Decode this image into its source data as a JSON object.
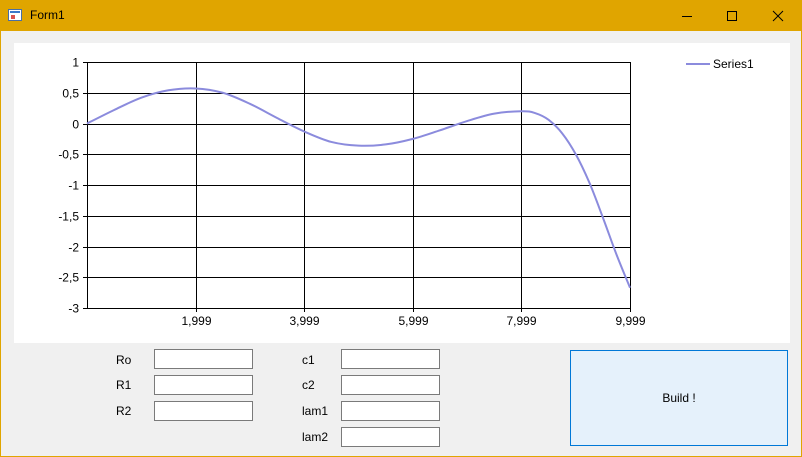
{
  "window": {
    "title": "Form1",
    "controls": {
      "minimize_icon": "minimize-icon",
      "maximize_icon": "maximize-icon",
      "close_icon": "close-icon"
    }
  },
  "colors": {
    "title_bar": "#e0a500",
    "series": "#8b8bdd",
    "button_bg": "#e5f1fb",
    "button_border": "#0078d7"
  },
  "chart_data": {
    "type": "line",
    "ylim": [
      -3,
      1
    ],
    "y_ticks": [
      1,
      0.5,
      0,
      -0.5,
      -1,
      -1.5,
      -2,
      -2.5,
      -3
    ],
    "y_tick_labels": [
      "1",
      "0,5",
      "0",
      "-0,5",
      "-1",
      "-1,5",
      "-2",
      "-2,5",
      "-3"
    ],
    "x_ticks": [
      1.999,
      3.999,
      5.999,
      7.999,
      9.999
    ],
    "x_tick_labels": [
      "1,999",
      "3,999",
      "5,999",
      "7,999",
      "9,999"
    ],
    "xlim": [
      0,
      9.999
    ],
    "grid": true,
    "legend_position": "top-right",
    "series": [
      {
        "name": "Series1",
        "x": [
          0,
          0.5,
          1,
          1.5,
          2,
          2.5,
          3,
          3.5,
          4,
          4.5,
          5,
          5.5,
          6,
          6.5,
          7,
          7.5,
          8,
          8.25,
          8.5,
          8.75,
          9,
          9.25,
          9.5,
          9.75,
          9.999
        ],
        "y": [
          0,
          0.22,
          0.42,
          0.54,
          0.57,
          0.5,
          0.32,
          0.09,
          -0.13,
          -0.3,
          -0.36,
          -0.34,
          -0.25,
          -0.11,
          0.04,
          0.16,
          0.2,
          0.17,
          0.06,
          -0.16,
          -0.5,
          -0.96,
          -1.53,
          -2.13,
          -2.67
        ]
      }
    ]
  },
  "form": {
    "ro_label": "Ro",
    "r1_label": "R1",
    "r2_label": "R2",
    "c1_label": "c1",
    "c2_label": "c2",
    "lam1_label": "lam1",
    "lam2_label": "lam2",
    "ro_value": "",
    "r1_value": "",
    "r2_value": "",
    "c1_value": "",
    "c2_value": "",
    "lam1_value": "",
    "lam2_value": "",
    "build_label": "Build !"
  }
}
